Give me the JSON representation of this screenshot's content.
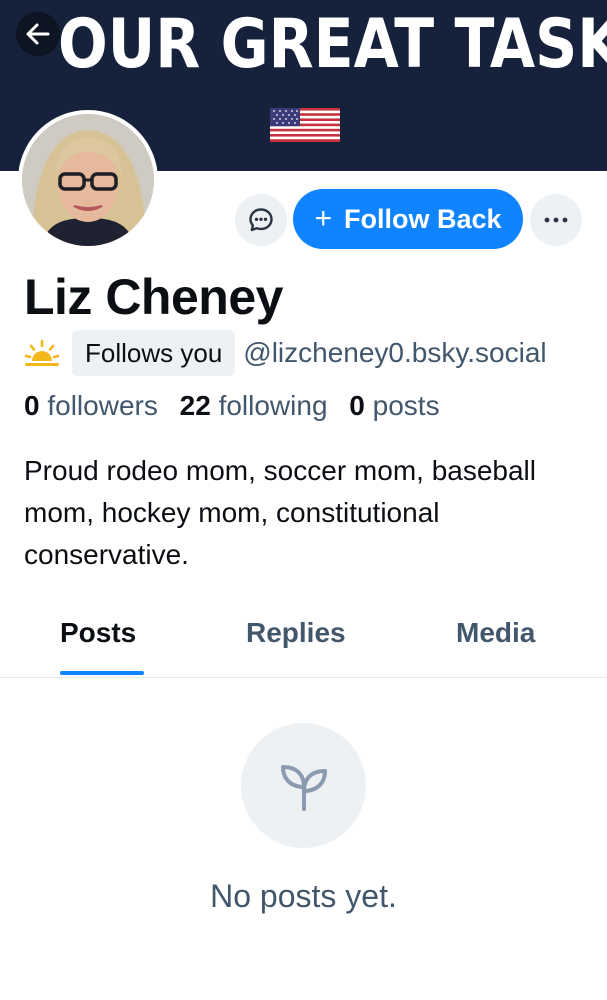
{
  "banner": {
    "title": "OUR GREAT TASK"
  },
  "profile": {
    "name": "Liz Cheney",
    "follows_you": "Follows you",
    "handle": "@lizcheney0.bsky.social",
    "stats": {
      "followers_count": "0",
      "followers_label": "followers",
      "following_count": "22",
      "following_label": "following",
      "posts_count": "0",
      "posts_label": "posts"
    },
    "bio": "Proud rodeo mom, soccer mom, baseball mom, hockey mom, constitutional conservative."
  },
  "actions": {
    "follow_back_label": "Follow Back"
  },
  "tabs": [
    {
      "label": "Posts",
      "active": true
    },
    {
      "label": "Replies",
      "active": false
    },
    {
      "label": "Media",
      "active": false
    }
  ],
  "empty_state": {
    "message": "No posts yet."
  },
  "icons": {
    "back": "arrow-left-icon",
    "message": "chat-bubble-icon",
    "more": "ellipsis-icon",
    "plus": "plus-icon",
    "new_account": "sunrise-icon",
    "empty": "sprout-icon"
  },
  "colors": {
    "accent": "#1083fe",
    "banner_bg": "#16213c",
    "muted_text": "#42576c",
    "chip_bg": "#eef1f4"
  }
}
